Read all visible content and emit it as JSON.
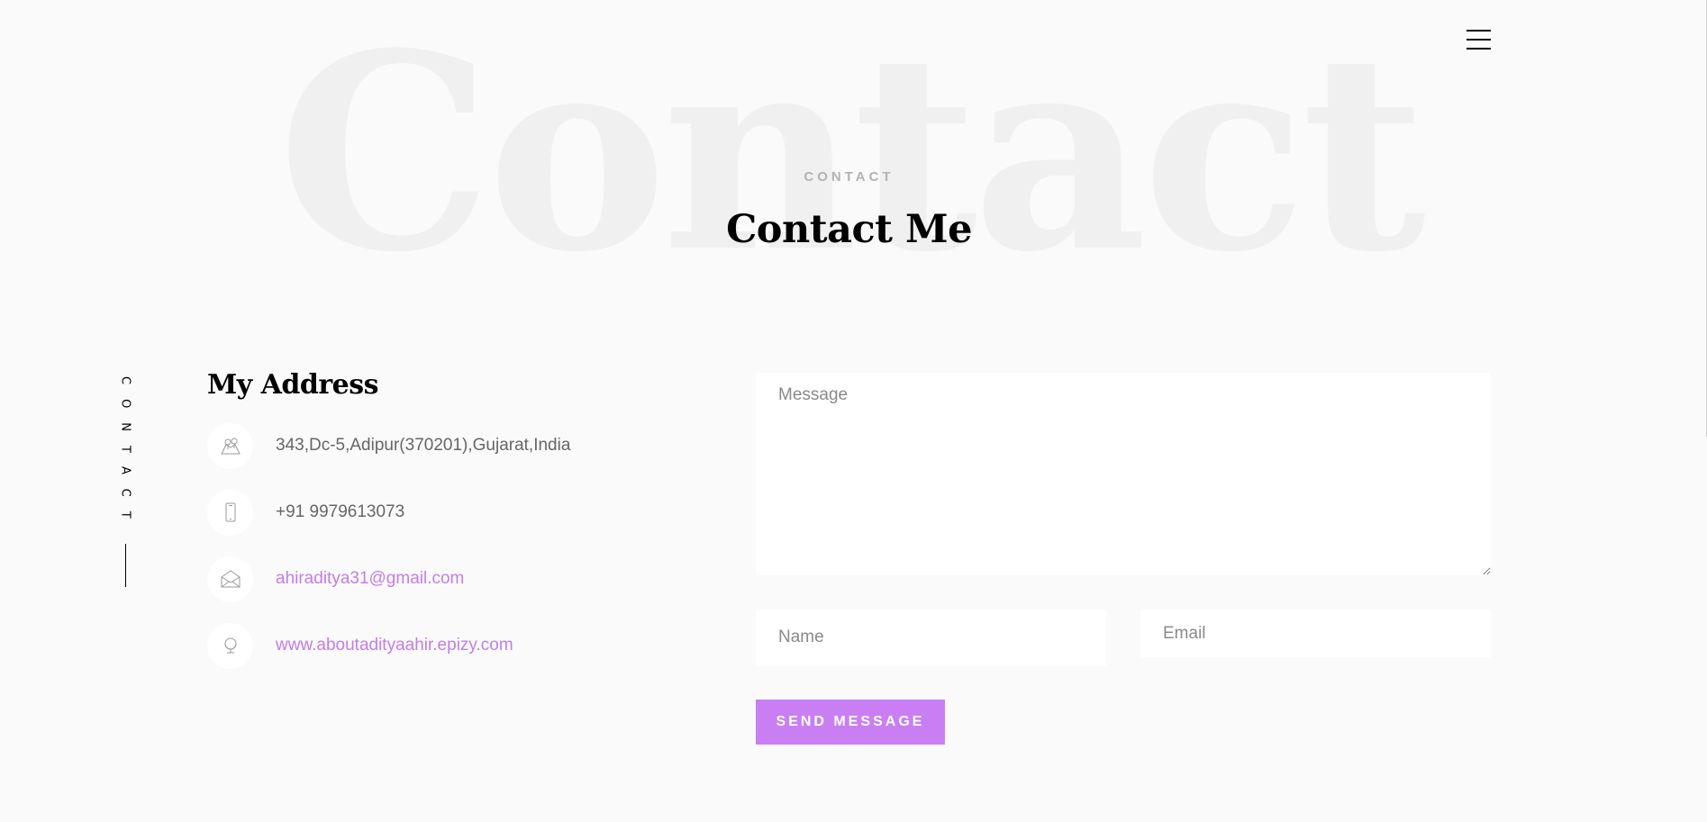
{
  "background_word": "Contact",
  "header": {
    "menu_icon": "hamburger-menu-icon"
  },
  "section": {
    "eyebrow": "CONTACT",
    "title": "Contact Me"
  },
  "side_label": "CONTACT",
  "address": {
    "title": "My Address",
    "items": [
      {
        "icon": "map-icon",
        "text": "343,Dc-5,Adipur(370201),Gujarat,India"
      },
      {
        "icon": "phone-icon",
        "text": "+91 9979613073"
      },
      {
        "icon": "envelope-icon",
        "text": "ahiraditya31@gmail.com"
      },
      {
        "icon": "globe-icon",
        "text": "www.aboutadityaahir.epizy.com"
      }
    ]
  },
  "form": {
    "message_placeholder": "Message",
    "name_placeholder": "Name",
    "email_placeholder": "Email",
    "submit_label": "SEND MESSAGE"
  },
  "colors": {
    "accent": "#c97ff3",
    "link": "#c47de8",
    "background": "#fafafa"
  }
}
